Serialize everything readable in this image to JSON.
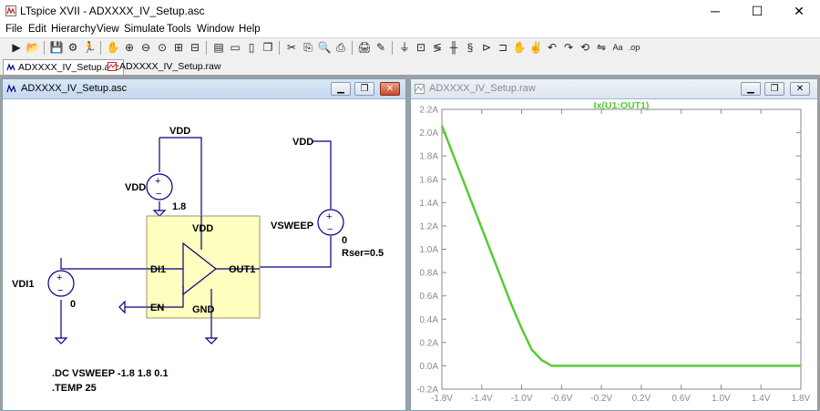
{
  "app": {
    "title": "LTspice XVII - ADXXXX_IV_Setup.asc",
    "minimize": "─",
    "maximize": "☐",
    "close": "✕"
  },
  "menu": [
    "File",
    "Edit",
    "Hierarchy",
    "View",
    "Simulate",
    "Tools",
    "Window",
    "Help"
  ],
  "toolbar_icons": [
    "run-icon",
    "open-icon",
    "save-icon",
    "control-panel-icon",
    "run-man-icon",
    "pan-hand-icon",
    "zoom-in-icon",
    "zoom-out-icon",
    "zoom-area-icon",
    "zoom-fit-icon",
    "autoscale-icon",
    "ruler-icon",
    "tile-horizontal-icon",
    "tile-vertical-icon",
    "cascade-icon",
    "cut-icon",
    "copy-icon",
    "find-icon",
    "print-icon",
    "print-preview-icon",
    "pencil-icon",
    "ground-icon",
    "label-icon",
    "resistor-icon",
    "capacitor-icon",
    "inductor-icon",
    "diode-icon",
    "component-icon",
    "move-hand-icon",
    "drag-hand-icon",
    "undo-icon",
    "redo-icon",
    "rotate-icon",
    "mirror-icon",
    "text-icon",
    "spice-directive-icon"
  ],
  "toolbar_glyphs": [
    "▶",
    "📂",
    "💾",
    "⚙",
    "🏃",
    "✋",
    "⊕",
    "⊖",
    "⊙",
    "⊞",
    "⊟",
    "▤",
    "▭",
    "▯",
    "❐",
    "✂",
    "⎘",
    "🔍",
    "⎙",
    "🖨",
    "✎",
    "⏚",
    "⊡",
    "≶",
    "╫",
    "§",
    "⊳",
    "⊐",
    "✋",
    "✌",
    "↶",
    "↷",
    "⟲",
    "⇋",
    "Aa",
    ".op"
  ],
  "tabs": [
    {
      "label": "ADXXXX_IV_Setup.asc",
      "active": true
    },
    {
      "label": "ADXXXX_IV_Setup.raw",
      "active": false
    }
  ],
  "schematic": {
    "title": "ADXXXX_IV_Setup.asc",
    "labels": {
      "vdd_top": "VDD",
      "vdd_source_name": "VDD",
      "vdd_source_value": "1.8",
      "vdd_right": "VDD",
      "vsweep_name": "VSWEEP",
      "vsweep_value": "0",
      "vsweep_rser": "Rser=0.5",
      "vdi1_name": "VDI1",
      "vdi1_value": "0",
      "pin_vdd": "VDD",
      "pin_di1": "DI1",
      "pin_out1": "OUT1",
      "pin_en": "EN",
      "pin_gnd": "GND",
      "directive_dc": ".DC VSWEEP -1.8 1.8 0.1",
      "directive_temp": ".TEMP 25"
    },
    "colors": {
      "wire": "#000080",
      "component_fill": "#ffffc0",
      "component_stroke": "#a09060",
      "symbol": "#000080"
    }
  },
  "waveform": {
    "title": "ADXXXX_IV_Setup.raw",
    "trace_label": "Ix(U1:OUT1)",
    "trace_color": "#55cc33",
    "colors": {
      "axis_text": "#8a8a8a",
      "grid": "#8a8a8a"
    }
  },
  "chart_data": {
    "type": "line",
    "title": "Ix(U1:OUT1)",
    "xlabel": "",
    "ylabel": "",
    "xlim": [
      -1.8,
      1.8
    ],
    "ylim": [
      -0.2,
      2.2
    ],
    "x_ticks": [
      "-1.8V",
      "-1.4V",
      "-1.0V",
      "-0.6V",
      "-0.2V",
      "0.2V",
      "0.6V",
      "1.0V",
      "1.4V",
      "1.8V"
    ],
    "x_tick_values": [
      -1.8,
      -1.4,
      -1.0,
      -0.6,
      -0.2,
      0.2,
      0.6,
      1.0,
      1.4,
      1.8
    ],
    "y_ticks": [
      "-0.2A",
      "0.0A",
      "0.2A",
      "0.4A",
      "0.6A",
      "0.8A",
      "1.0A",
      "1.2A",
      "1.4A",
      "1.6A",
      "1.8A",
      "2.0A",
      "2.2A"
    ],
    "y_tick_values": [
      -0.2,
      0.0,
      0.2,
      0.4,
      0.6,
      0.8,
      1.0,
      1.2,
      1.4,
      1.6,
      1.8,
      2.0,
      2.2
    ],
    "grid": false,
    "series": [
      {
        "name": "Ix(U1:OUT1)",
        "x": [
          -1.8,
          -1.7,
          -1.6,
          -1.5,
          -1.4,
          -1.3,
          -1.2,
          -1.1,
          -1.0,
          -0.9,
          -0.8,
          -0.7,
          -0.6,
          -0.5,
          -0.4,
          -0.3,
          -0.2,
          -0.1,
          0.0,
          0.1,
          0.2,
          0.3,
          0.4,
          0.5,
          0.6,
          0.7,
          0.8,
          0.9,
          1.0,
          1.1,
          1.2,
          1.3,
          1.4,
          1.5,
          1.6,
          1.7,
          1.8
        ],
        "y": [
          2.06,
          1.84,
          1.62,
          1.4,
          1.18,
          0.96,
          0.74,
          0.52,
          0.32,
          0.14,
          0.05,
          0.0,
          0.0,
          0.0,
          0.0,
          0.0,
          0.0,
          0.0,
          0.0,
          0.0,
          0.0,
          0.0,
          0.0,
          0.0,
          0.0,
          0.0,
          0.0,
          0.0,
          0.0,
          0.0,
          0.0,
          0.0,
          0.0,
          0.0,
          0.0,
          0.0,
          0.0
        ]
      }
    ]
  }
}
